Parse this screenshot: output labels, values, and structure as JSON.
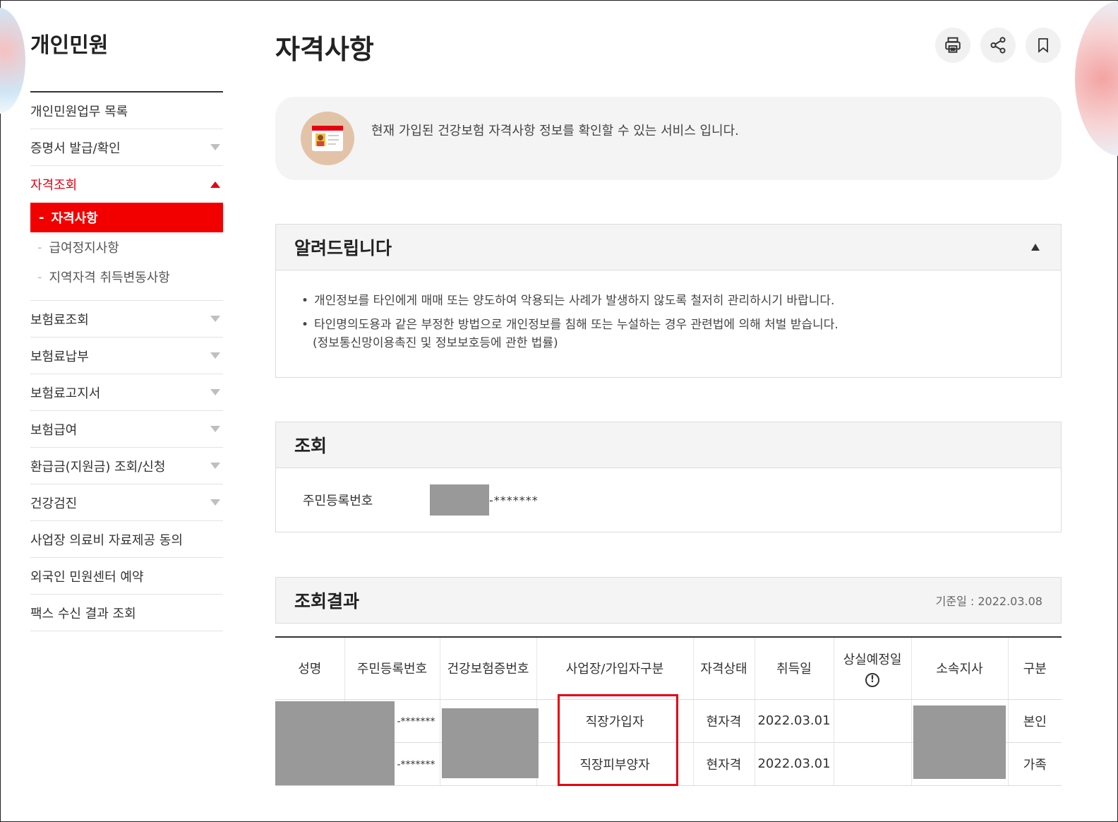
{
  "sidebar": {
    "title": "개인민원",
    "items": [
      {
        "label": "개인민원업무 목록",
        "caret": false
      },
      {
        "label": "증명서 발급/확인",
        "caret": true
      },
      {
        "label": "자격조회",
        "caret": true,
        "active": true
      }
    ],
    "submenu": [
      {
        "label": "자격사항",
        "active": true
      },
      {
        "label": "급여정지사항"
      },
      {
        "label": "지역자격 취득변동사항"
      }
    ],
    "items_after": [
      {
        "label": "보험료조회",
        "caret": true
      },
      {
        "label": "보험료납부",
        "caret": true
      },
      {
        "label": "보험료고지서",
        "caret": true
      },
      {
        "label": "보험급여",
        "caret": true
      },
      {
        "label": "환급금(지원금) 조회/신청",
        "caret": true
      },
      {
        "label": "건강검진",
        "caret": true
      },
      {
        "label": "사업장 의료비 자료제공 동의",
        "caret": false
      },
      {
        "label": "외국인 민원센터 예약",
        "caret": false
      },
      {
        "label": "팩스 수신 결과 조회",
        "caret": false
      }
    ]
  },
  "page": {
    "title": "자격사항",
    "info_text": "현재 가입된 건강보험 자격사항 정보를 확인할 수 있는 서비스 입니다.",
    "tools": [
      "print-icon",
      "share-icon",
      "bookmark-icon"
    ]
  },
  "notice": {
    "title": "알려드립니다",
    "bullets": [
      "개인정보를 타인에게 매매 또는 양도하여 악용되는 사례가 발생하지 않도록 철저히 관리하시기 바랍니다.",
      "타인명의도용과 같은 부정한 방법으로 개인정보를 침해 또는 누설하는 경우 관련법에 의해 처벌 받습니다."
    ],
    "sub_note": "(정보통신망이용촉진 및 정보보호등에 관한 법률)"
  },
  "query": {
    "title": "조회",
    "label": "주민등록번호",
    "masked_value": "-*******"
  },
  "result": {
    "title": "조회결과",
    "base_date": "기준일 : 2022.03.08",
    "headers": [
      "성명",
      "주민등록번호",
      "건강보험증번호",
      "사업장/가입자구분",
      "자격상태",
      "취득일",
      "상실예정일",
      "소속지사",
      "구분"
    ],
    "rows": [
      {
        "rrn": "-*******",
        "type": "직장가입자",
        "status": "현자격",
        "acquired": "2022.03.01",
        "category": "본인"
      },
      {
        "rrn": "-*******",
        "type": "직장피부양자",
        "status": "현자격",
        "acquired": "2022.03.01",
        "category": "가족"
      }
    ]
  },
  "colors": {
    "accent": "#e60012",
    "active_bg": "#f20000",
    "masked": "#999999"
  }
}
